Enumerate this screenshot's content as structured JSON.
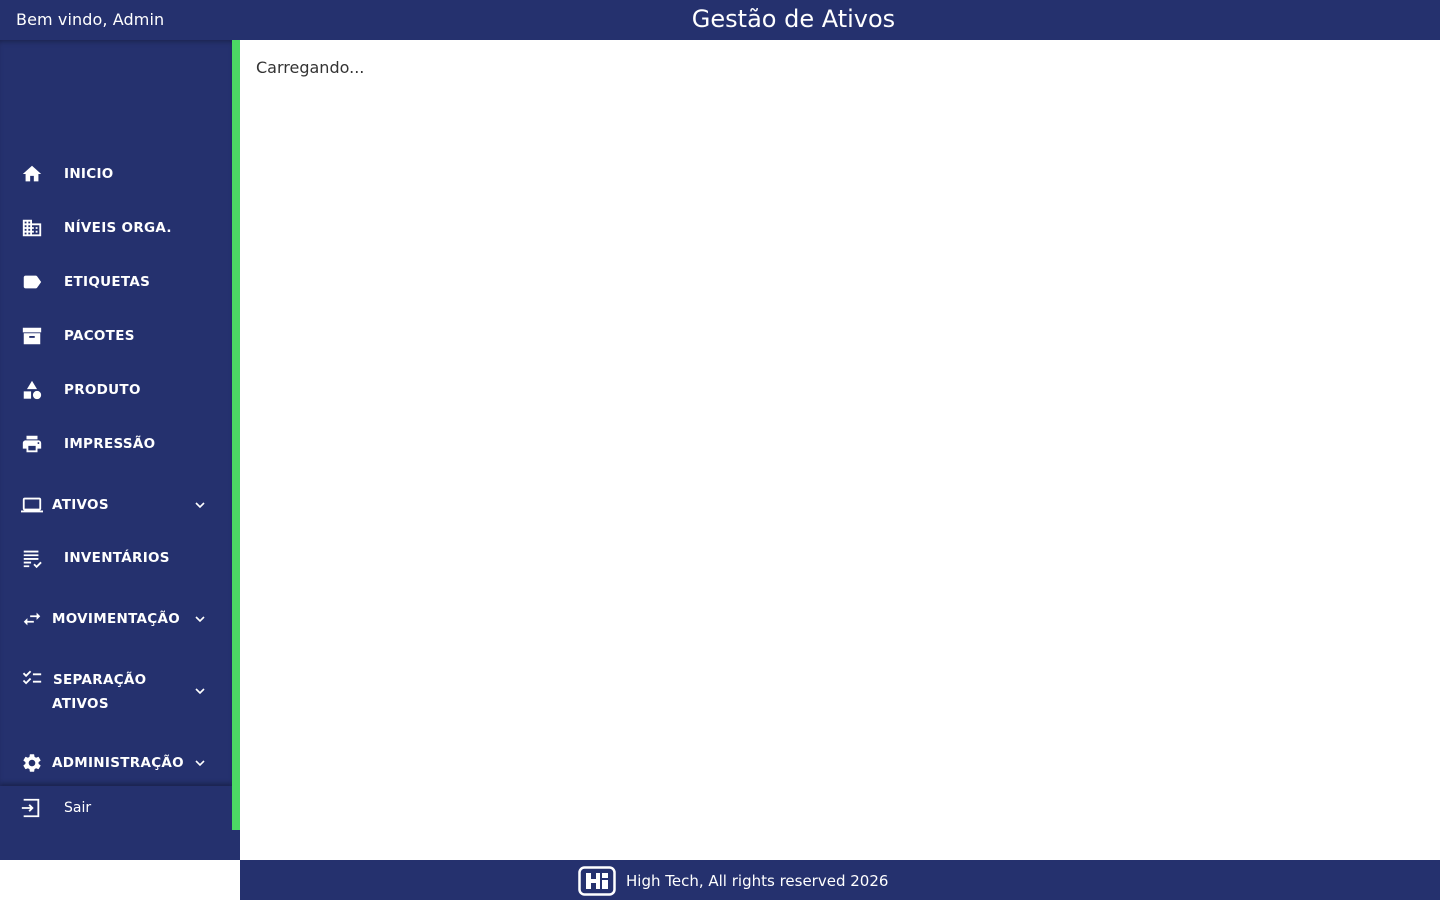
{
  "header": {
    "welcome": "Bem vindo, Admin",
    "title": "Gestão de Ativos"
  },
  "sidebar": {
    "items": [
      {
        "label": "INICIO",
        "icon": "home-icon"
      },
      {
        "label": "NÍVEIS ORGA.",
        "icon": "building-icon"
      },
      {
        "label": "ETIQUETAS",
        "icon": "label-icon"
      },
      {
        "label": "PACOTES",
        "icon": "archive-icon"
      },
      {
        "label": "PRODUTO",
        "icon": "category-icon"
      },
      {
        "label": "IMPRESSÃO",
        "icon": "print-icon"
      },
      {
        "label": "ATIVOS",
        "icon": "laptop-icon",
        "expandable": true
      },
      {
        "label": "INVENTÁRIOS",
        "icon": "checklist-icon"
      },
      {
        "label": "MOVIMENTAÇÃO",
        "icon": "swap-icon",
        "expandable": true
      },
      {
        "label_line1": "SEPARAÇÃO",
        "label_line2": "ATIVOS",
        "icon": "tasks-icon",
        "expandable": true
      },
      {
        "label": "ADMINISTRAÇÃO",
        "icon": "gear-icon",
        "expandable": true
      }
    ],
    "logout_label": "Sair"
  },
  "main": {
    "loading_text": "Carregando..."
  },
  "footer": {
    "copyright": "High Tech, All rights reserved 2026"
  },
  "colors": {
    "primary": "#25316e",
    "accent": "#4cd964",
    "background": "#ffffff"
  }
}
